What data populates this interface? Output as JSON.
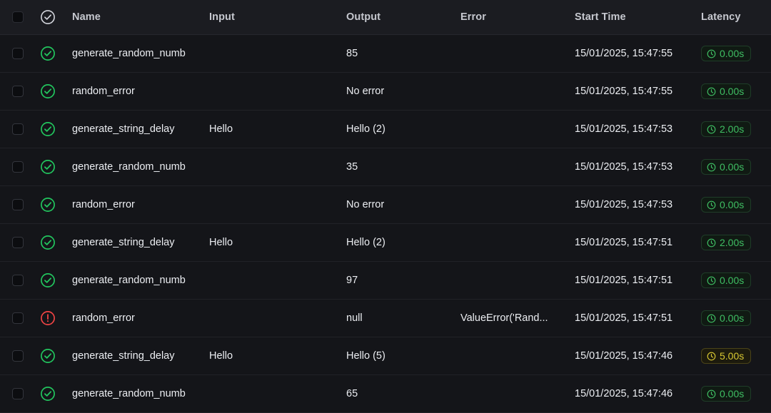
{
  "table": {
    "columns": [
      {
        "key": "select",
        "label": "",
        "icon": "checkbox-icon"
      },
      {
        "key": "status",
        "label": "",
        "icon": "check-circle-icon"
      },
      {
        "key": "name",
        "label": "Name"
      },
      {
        "key": "input",
        "label": "Input"
      },
      {
        "key": "output",
        "label": "Output"
      },
      {
        "key": "error",
        "label": "Error"
      },
      {
        "key": "start",
        "label": "Start Time"
      },
      {
        "key": "latency",
        "label": "Latency"
      }
    ],
    "header": {
      "name": "Name",
      "input": "Input",
      "output": "Output",
      "error": "Error",
      "start_time": "Start Time",
      "latency": "Latency"
    },
    "rows": [
      {
        "status": "success",
        "name": "generate_random_numb",
        "input": "",
        "output": "85",
        "error": "",
        "start_time": "15/01/2025, 15:47:55",
        "latency": "0.00s",
        "latency_level": "green"
      },
      {
        "status": "success",
        "name": "random_error",
        "input": "",
        "output": "No error",
        "error": "",
        "start_time": "15/01/2025, 15:47:55",
        "latency": "0.00s",
        "latency_level": "green"
      },
      {
        "status": "success",
        "name": "generate_string_delay",
        "input": "Hello",
        "output": "Hello (2)",
        "error": "",
        "start_time": "15/01/2025, 15:47:53",
        "latency": "2.00s",
        "latency_level": "green"
      },
      {
        "status": "success",
        "name": "generate_random_numb",
        "input": "",
        "output": "35",
        "error": "",
        "start_time": "15/01/2025, 15:47:53",
        "latency": "0.00s",
        "latency_level": "green"
      },
      {
        "status": "success",
        "name": "random_error",
        "input": "",
        "output": "No error",
        "error": "",
        "start_time": "15/01/2025, 15:47:53",
        "latency": "0.00s",
        "latency_level": "green"
      },
      {
        "status": "success",
        "name": "generate_string_delay",
        "input": "Hello",
        "output": "Hello (2)",
        "error": "",
        "start_time": "15/01/2025, 15:47:51",
        "latency": "2.00s",
        "latency_level": "green"
      },
      {
        "status": "success",
        "name": "generate_random_numb",
        "input": "",
        "output": "97",
        "error": "",
        "start_time": "15/01/2025, 15:47:51",
        "latency": "0.00s",
        "latency_level": "green"
      },
      {
        "status": "error",
        "name": "random_error",
        "input": "",
        "output": "null",
        "error": "ValueError('Rand...",
        "start_time": "15/01/2025, 15:47:51",
        "latency": "0.00s",
        "latency_level": "green"
      },
      {
        "status": "success",
        "name": "generate_string_delay",
        "input": "Hello",
        "output": "Hello (5)",
        "error": "",
        "start_time": "15/01/2025, 15:47:46",
        "latency": "5.00s",
        "latency_level": "amber"
      },
      {
        "status": "success",
        "name": "generate_random_numb",
        "input": "",
        "output": "65",
        "error": "",
        "start_time": "15/01/2025, 15:47:46",
        "latency": "0.00s",
        "latency_level": "green"
      }
    ]
  },
  "colors": {
    "success": "#22c55e",
    "error": "#ef4444",
    "error_text": "#f2716e",
    "latency_green": "#3fbf63",
    "latency_amber": "#d8c832",
    "header_text": "#c6c8cf",
    "row_text": "#eceef2",
    "header_bg": "#1b1c21",
    "row_bg": "#141519"
  }
}
